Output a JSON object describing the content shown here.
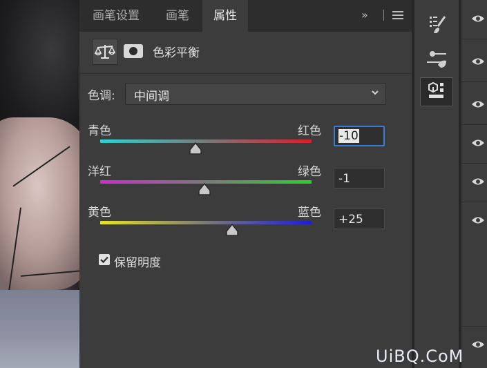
{
  "tabs": [
    {
      "label": "画笔设置",
      "active": false
    },
    {
      "label": "画笔",
      "active": false
    },
    {
      "label": "属性",
      "active": true
    }
  ],
  "tabbar": {
    "more_label": "»",
    "menu_icon": "menu-icon"
  },
  "panel": {
    "title": "色彩平衡",
    "adjustment_icon": "balance-scale-icon",
    "mask_icon": "mask-icon"
  },
  "tone": {
    "label": "色调:",
    "selected": "中间调"
  },
  "sliders": [
    {
      "left_label": "青色",
      "right_label": "红色",
      "value": "-10",
      "level": -10,
      "gradient": [
        "#2fd0d0",
        "#d51f2b"
      ],
      "focused": true
    },
    {
      "left_label": "洋红",
      "right_label": "绿色",
      "value": "-1",
      "level": -1,
      "gradient": [
        "#d12ad1",
        "#2bd12b"
      ],
      "focused": false
    },
    {
      "left_label": "黄色",
      "right_label": "蓝色",
      "value": "+25",
      "level": 25,
      "gradient": [
        "#e6e22a",
        "#1d1dd6"
      ],
      "focused": false
    }
  ],
  "preserve_luminosity": {
    "label": "保留明度",
    "checked": true
  },
  "toolbar_icons": [
    "brush-presets-icon",
    "adjustments-icon",
    "properties-icon"
  ],
  "watermark": "UiBQ.CoM"
}
